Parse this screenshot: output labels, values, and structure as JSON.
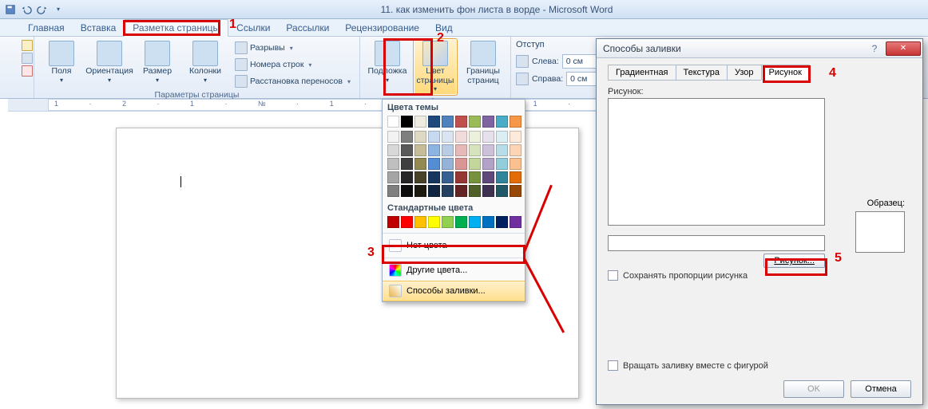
{
  "window_title": "11. как изменить фон листа в ворде  -  Microsoft Word",
  "ribbon_tabs": [
    "Главная",
    "Вставка",
    "Разметка страницы",
    "Ссылки",
    "Рассылки",
    "Рецензирование",
    "Вид"
  ],
  "ribbon_active_tab_index": 2,
  "groups": {
    "page_setup_label": "Параметры страницы",
    "margins": "Поля",
    "orientation": "Ориентация",
    "size": "Размер",
    "columns": "Колонки",
    "breaks": "Разрывы",
    "line_numbers": "Номера строк",
    "hyphenation": "Расстановка переносов",
    "watermark": "Подложка",
    "page_color": "Цвет страницы",
    "page_borders": "Границы страниц",
    "indent_label": "Отступ",
    "indent_left": "Слева:",
    "indent_right": "Справа:",
    "indent_value": "0 см"
  },
  "color_popup": {
    "theme_colors": "Цвета темы",
    "standard_colors": "Стандартные цвета",
    "no_color": "Нет цвета",
    "more_colors": "Другие цвета...",
    "fill_effects": "Способы заливки...",
    "theme_row1": [
      "#ffffff",
      "#000000",
      "#eeece1",
      "#1f497d",
      "#4f81bd",
      "#c0504d",
      "#9bbb59",
      "#8064a2",
      "#4bacc6",
      "#f79646"
    ],
    "theme_shades": [
      [
        "#f2f2f2",
        "#7f7f7f",
        "#ddd9c3",
        "#c6d9f0",
        "#dbe5f1",
        "#f2dcdb",
        "#ebf1dd",
        "#e5e0ec",
        "#dbeef3",
        "#fdeada"
      ],
      [
        "#d8d8d8",
        "#595959",
        "#c4bd97",
        "#8db3e2",
        "#b8cce4",
        "#e5b9b7",
        "#d7e3bc",
        "#ccc1d9",
        "#b7dde8",
        "#fbd5b5"
      ],
      [
        "#bfbfbf",
        "#3f3f3f",
        "#938953",
        "#548dd4",
        "#95b3d7",
        "#d99694",
        "#c3d69b",
        "#b2a2c7",
        "#92cddc",
        "#fac08f"
      ],
      [
        "#a5a5a5",
        "#262626",
        "#494429",
        "#17365d",
        "#366092",
        "#953734",
        "#76923c",
        "#5f497a",
        "#31859b",
        "#e36c09"
      ],
      [
        "#7f7f7f",
        "#0c0c0c",
        "#1d1b10",
        "#0f243e",
        "#244061",
        "#632423",
        "#4f6128",
        "#3f3151",
        "#205867",
        "#974806"
      ]
    ],
    "standard_row": [
      "#c00000",
      "#ff0000",
      "#ffc000",
      "#ffff00",
      "#92d050",
      "#00b050",
      "#00b0f0",
      "#0070c0",
      "#002060",
      "#7030a0"
    ]
  },
  "dialog": {
    "title": "Способы заливки",
    "tabs": [
      "Градиентная",
      "Текстура",
      "Узор",
      "Рисунок"
    ],
    "active_tab_index": 3,
    "label_picture": "Рисунок:",
    "btn_picture": "Рисунок...",
    "chk_aspect": "Сохранять пропорции рисунка",
    "chk_rotate": "Вращать заливку вместе с фигурой",
    "sample": "Образец:",
    "ok": "OK",
    "cancel": "Отмена"
  },
  "ruler_text": "1 · 2 · 1 · № · 1 · 1 · 2 · 1 · 3 · 1 · 4 · 1 · 5 · 1 · 6 · 1 · 7"
}
